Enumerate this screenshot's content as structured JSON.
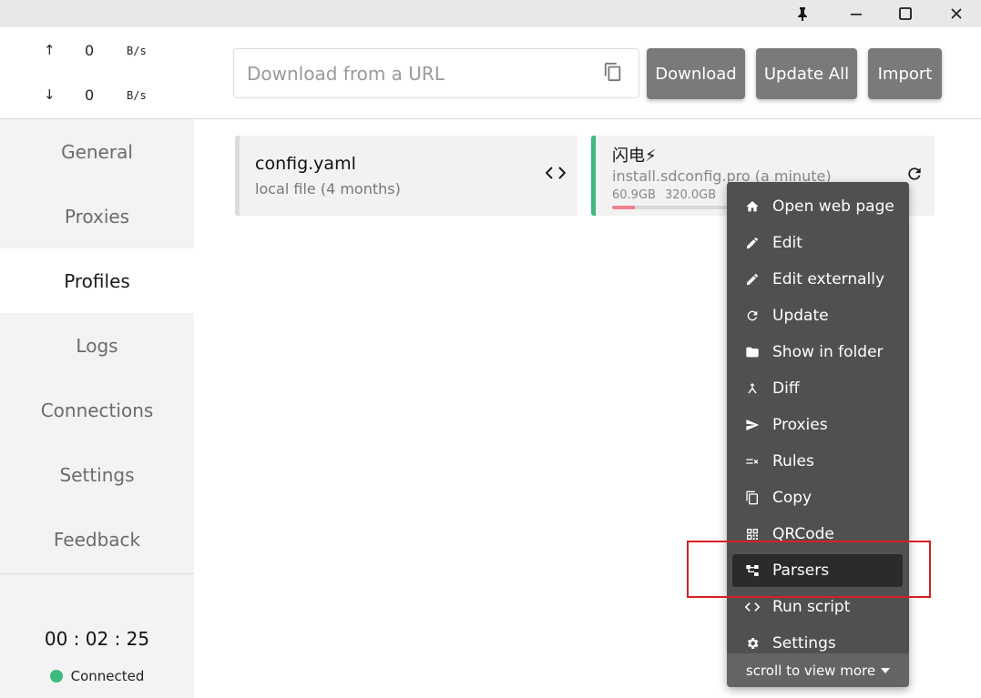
{
  "traffic": {
    "up_arrow": "↑",
    "up_value": "0",
    "up_unit": "B/s",
    "down_arrow": "↓",
    "down_value": "0",
    "down_unit": "B/s"
  },
  "nav": [
    {
      "label": "General"
    },
    {
      "label": "Proxies"
    },
    {
      "label": "Profiles"
    },
    {
      "label": "Logs"
    },
    {
      "label": "Connections"
    },
    {
      "label": "Settings"
    },
    {
      "label": "Feedback"
    }
  ],
  "footer": {
    "timer": "00 : 02 : 25",
    "status": "Connected",
    "status_color": "#3dba7e"
  },
  "topbar": {
    "url_placeholder": "Download from a URL",
    "download_label": "Download",
    "update_all_label": "Update All",
    "import_label": "Import"
  },
  "profiles": [
    {
      "title": "config.yaml",
      "subtitle": "local file (4 months)"
    },
    {
      "title": "闪电⚡",
      "subtitle": "install.sdconfig.pro (a minute)",
      "used": "60.9GB",
      "total": "320.0GB",
      "usage_fraction": 0.19,
      "accent": "#3dba7e"
    }
  ],
  "context_menu": {
    "items": [
      {
        "label": "Open web page",
        "icon": "home-icon"
      },
      {
        "label": "Edit",
        "icon": "pencil-icon"
      },
      {
        "label": "Edit externally",
        "icon": "pencil-icon"
      },
      {
        "label": "Update",
        "icon": "refresh-icon"
      },
      {
        "label": "Show in folder",
        "icon": "folder-icon"
      },
      {
        "label": "Diff",
        "icon": "merge-icon"
      },
      {
        "label": "Proxies",
        "icon": "send-icon"
      },
      {
        "label": "Rules",
        "icon": "rules-icon"
      },
      {
        "label": "Copy",
        "icon": "copy-icon"
      },
      {
        "label": "QRCode",
        "icon": "qrcode-icon"
      },
      {
        "label": "Parsers",
        "icon": "tree-icon",
        "selected": true
      },
      {
        "label": "Run script",
        "icon": "code-icon"
      },
      {
        "label": "Settings",
        "icon": "gear-icon"
      }
    ],
    "footer_label": "scroll to view more"
  },
  "colors": {
    "accent": "#3dba7e",
    "button": "#7a7a7a",
    "menu_bg": "#505050",
    "highlight": "#d92020"
  }
}
